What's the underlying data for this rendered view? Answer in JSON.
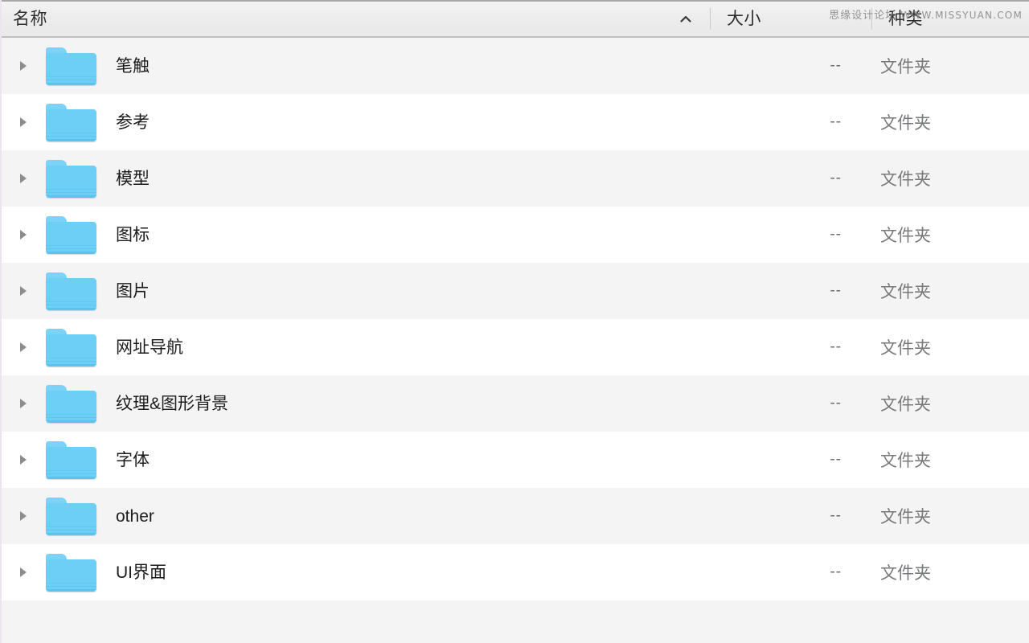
{
  "header": {
    "columns": [
      {
        "id": "name",
        "label": "名称",
        "sort_indicator": "chevron-up-icon"
      },
      {
        "id": "size",
        "label": "大小"
      },
      {
        "id": "kind",
        "label": "种类"
      }
    ]
  },
  "watermark": {
    "site_name": "思缘设计论坛",
    "url": "WWW.MISSYUAN.COM"
  },
  "colors": {
    "folder_blue": "#6ecff6",
    "row_alt": "#f4f4f4",
    "row_base": "#ffffff",
    "header_bg": "#ececec",
    "text_primary": "#1c1c1c",
    "text_secondary": "#77797b"
  },
  "rows": [
    {
      "name": "笔触",
      "size": "--",
      "kind": "文件夹",
      "icon": "folder-icon",
      "disclosure": "triangle-right-icon"
    },
    {
      "name": "参考",
      "size": "--",
      "kind": "文件夹",
      "icon": "folder-icon",
      "disclosure": "triangle-right-icon"
    },
    {
      "name": "模型",
      "size": "--",
      "kind": "文件夹",
      "icon": "folder-icon",
      "disclosure": "triangle-right-icon"
    },
    {
      "name": "图标",
      "size": "--",
      "kind": "文件夹",
      "icon": "folder-icon",
      "disclosure": "triangle-right-icon"
    },
    {
      "name": "图片",
      "size": "--",
      "kind": "文件夹",
      "icon": "folder-icon",
      "disclosure": "triangle-right-icon"
    },
    {
      "name": "网址导航",
      "size": "--",
      "kind": "文件夹",
      "icon": "folder-icon",
      "disclosure": "triangle-right-icon"
    },
    {
      "name": "纹理&图形背景",
      "size": "--",
      "kind": "文件夹",
      "icon": "folder-icon",
      "disclosure": "triangle-right-icon"
    },
    {
      "name": "字体",
      "size": "--",
      "kind": "文件夹",
      "icon": "folder-icon",
      "disclosure": "triangle-right-icon"
    },
    {
      "name": "other",
      "size": "--",
      "kind": "文件夹",
      "icon": "folder-icon",
      "disclosure": "triangle-right-icon"
    },
    {
      "name": "UI界面",
      "size": "--",
      "kind": "文件夹",
      "icon": "folder-icon",
      "disclosure": "triangle-right-icon"
    }
  ]
}
